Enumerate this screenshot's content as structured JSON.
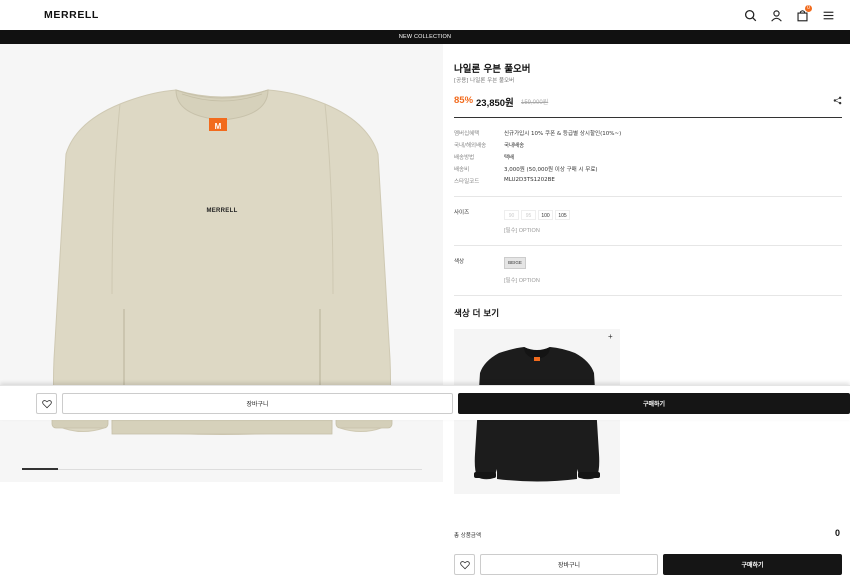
{
  "header": {
    "logo": "MERRELL",
    "icons": [
      "search-icon",
      "user-icon",
      "cart-icon",
      "menu-icon"
    ],
    "cart_count": "0"
  },
  "banner": {
    "text": "NEW COLLECTION"
  },
  "gallery": {
    "product_logo_text": "MERRELL",
    "tag_text": "M",
    "progress": 0.09
  },
  "product": {
    "title": "나일론 우븐 풀오버",
    "subtitle": "[공용] 나일론 우븐 풀오버",
    "discount": "85%",
    "price": "23,850원",
    "original_price": "159,000원"
  },
  "specs": [
    {
      "label": "멤버십혜택",
      "value": "신규가입시 10% 쿠폰 & 등급별 상시할인(10%~)"
    },
    {
      "label": "국내/해외배송",
      "value": "국내배송"
    },
    {
      "label": "배송방법",
      "value": "택배"
    },
    {
      "label": "배송비",
      "value": "3,000원 (50,000원 이상 구매 시 무료)"
    },
    {
      "label": "스타일코드",
      "value": "MLU2D3TS1202BE"
    }
  ],
  "options": {
    "size_label": "사이즈",
    "sizes": [
      {
        "label": "90",
        "available": false
      },
      {
        "label": "95",
        "available": false
      },
      {
        "label": "100",
        "available": true
      },
      {
        "label": "105",
        "available": true
      }
    ],
    "size_hint": "[필수] OPTION",
    "color_label": "색상",
    "color_value": "BEIGE",
    "color_hint": "[필수] OPTION"
  },
  "more_colors": {
    "title": "색상 더 보기",
    "plus": "+"
  },
  "total": {
    "label": "총 상품금액",
    "value": "0"
  },
  "sticky_bar": {
    "cart_label": "장바구니",
    "buy_label": "구매하기"
  },
  "bottom_bar": {
    "cart_label": "장바구니",
    "buy_label": "구매하기"
  },
  "colors": {
    "accent": "#f26b1d",
    "dark": "#151515",
    "sweater_beige": "#ddd8c4",
    "sweater_black": "#1c1c1c"
  }
}
